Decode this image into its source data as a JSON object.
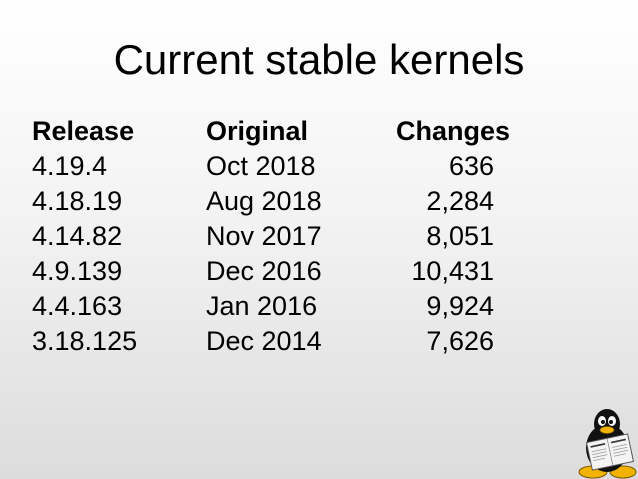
{
  "slide": {
    "title": "Current stable kernels"
  },
  "table": {
    "headers": [
      "Release",
      "Original",
      "Changes"
    ],
    "rows": [
      [
        "4.19.4",
        "Oct 2018",
        "636"
      ],
      [
        "4.18.19",
        "Aug 2018",
        "2,284"
      ],
      [
        "4.14.82",
        "Nov 2017",
        "8,051"
      ],
      [
        "4.9.139",
        "Dec 2016",
        "10,431"
      ],
      [
        "4.4.163",
        "Jan 2016",
        "9,924"
      ],
      [
        "3.18.125",
        "Dec 2014",
        "7,626"
      ]
    ]
  },
  "logo": {
    "icon": "tux-penguin-icon"
  }
}
